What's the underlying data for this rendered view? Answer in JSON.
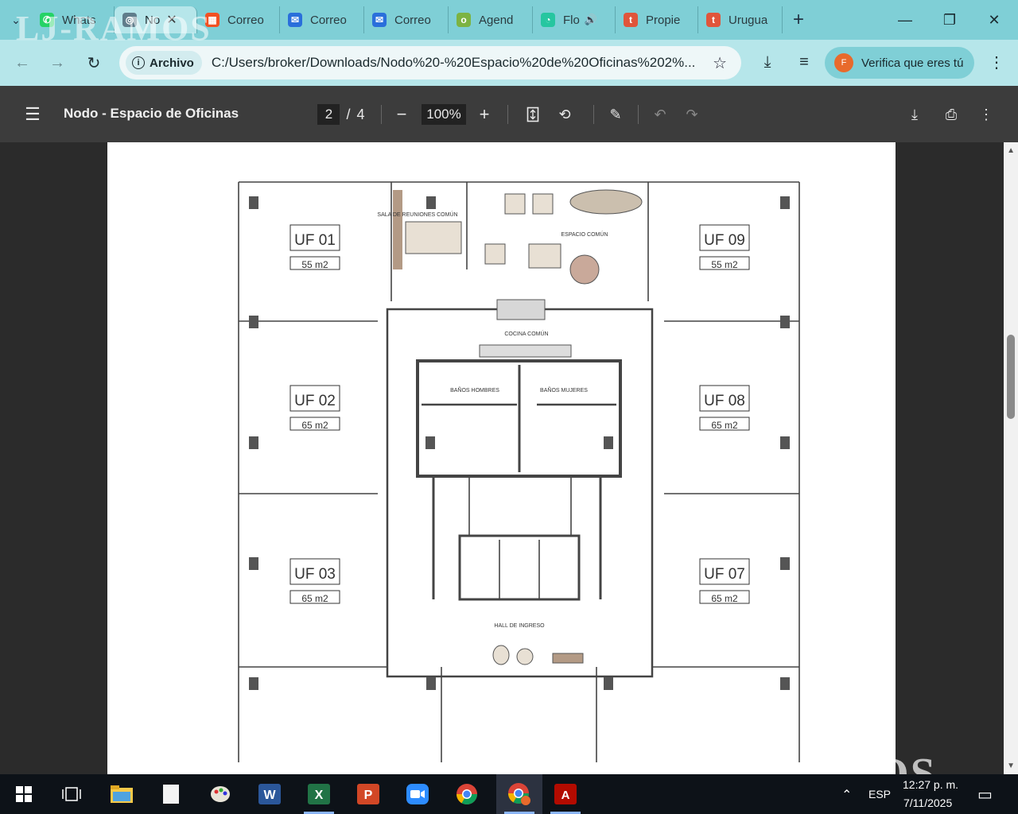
{
  "tabs": [
    {
      "label": "Whats",
      "color": "#25d366",
      "glyph": "✆"
    },
    {
      "label": "No",
      "color": "#607d8b",
      "glyph": "◎",
      "active": true
    },
    {
      "label": "Correo",
      "color": "#f25022",
      "glyph": "▦"
    },
    {
      "label": "Correo",
      "color": "#2a6fdb",
      "glyph": "✉"
    },
    {
      "label": "Correo",
      "color": "#2a6fdb",
      "glyph": "✉"
    },
    {
      "label": "Agend",
      "color": "#7cb342",
      "glyph": "o"
    },
    {
      "label": "Flo",
      "color": "#26c6a0",
      "glyph": "◔",
      "audio": "🔊"
    },
    {
      "label": "Propie",
      "color": "#e0553b",
      "glyph": "t"
    },
    {
      "label": "Urugua",
      "color": "#e0553b",
      "glyph": "t"
    }
  ],
  "address": {
    "chip": "Archivo",
    "url": "C:/Users/broker/Downloads/Nodo%20-%20Espacio%20de%20Oficinas%202%..."
  },
  "profile": {
    "label": "Verifica que eres tú",
    "initial": "F"
  },
  "pdf": {
    "title": "Nodo - Espacio de Oficinas",
    "page": "2",
    "page_sep": "/",
    "total_pages": "4",
    "zoom": "100%"
  },
  "plan": {
    "units": [
      {
        "name": "UF 01",
        "area": "55 m2"
      },
      {
        "name": "UF 02",
        "area": "65 m2"
      },
      {
        "name": "UF 03",
        "area": "65 m2"
      },
      {
        "name": "UF 09",
        "area": "55 m2"
      },
      {
        "name": "UF 08",
        "area": "65 m2"
      },
      {
        "name": "UF 07",
        "area": "65 m2"
      }
    ],
    "labels": {
      "meeting": "SALA DE REUNIONES COMÚN",
      "common": "ESPACIO COMÚN",
      "kitchen": "COCINA COMÚN",
      "men": "BAÑOS HOMBRES",
      "women": "BAÑOS MUJERES",
      "hall": "HALL DE INGRESO"
    }
  },
  "watermark": "LJ-RAMOS",
  "watermark2": "LJRAMOS",
  "system": {
    "lang": "ESP",
    "time": "12:27 p. m.",
    "date": "7/11/2025"
  }
}
